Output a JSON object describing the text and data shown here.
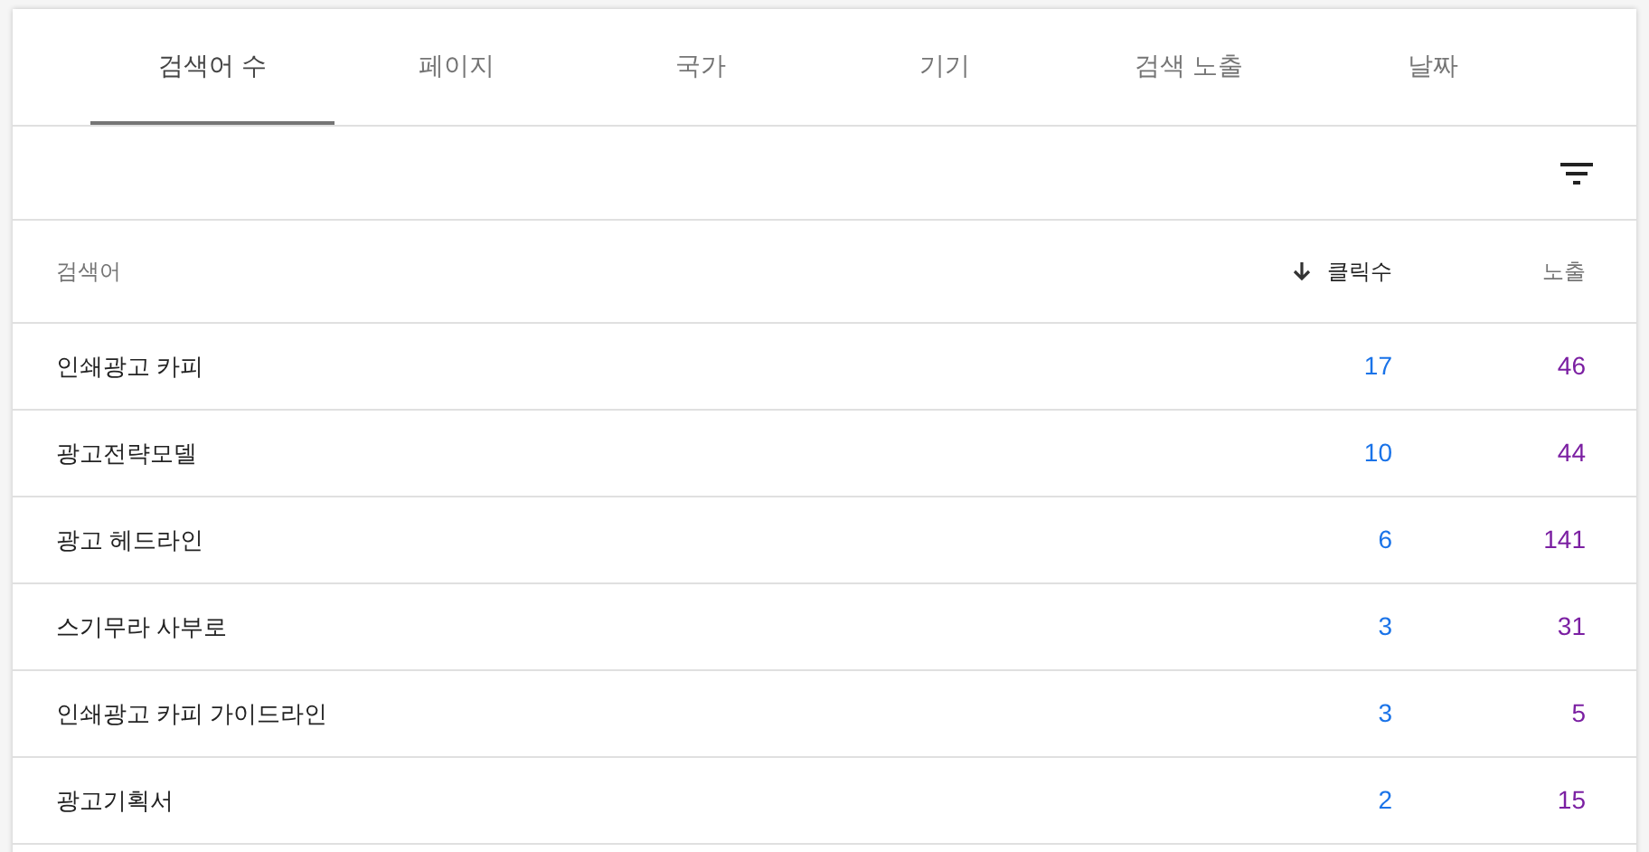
{
  "tabs": [
    {
      "label": "검색어 수",
      "selected": true
    },
    {
      "label": "페이지",
      "selected": false
    },
    {
      "label": "국가",
      "selected": false
    },
    {
      "label": "기기",
      "selected": false
    },
    {
      "label": "검색 노출",
      "selected": false
    },
    {
      "label": "날짜",
      "selected": false
    }
  ],
  "table": {
    "columns": [
      {
        "label": "검색어",
        "sorted": false
      },
      {
        "label": "클릭수",
        "sorted": true
      },
      {
        "label": "노출",
        "sorted": false
      }
    ],
    "rows": [
      {
        "query": "인쇄광고 카피",
        "clicks": "17",
        "impressions": "46"
      },
      {
        "query": "광고전략모델",
        "clicks": "10",
        "impressions": "44"
      },
      {
        "query": "광고 헤드라인",
        "clicks": "6",
        "impressions": "141"
      },
      {
        "query": "스기무라 사부로",
        "clicks": "3",
        "impressions": "31"
      },
      {
        "query": "인쇄광고 카피 가이드라인",
        "clicks": "3",
        "impressions": "5"
      },
      {
        "query": "광고기획서",
        "clicks": "2",
        "impressions": "15"
      }
    ]
  }
}
